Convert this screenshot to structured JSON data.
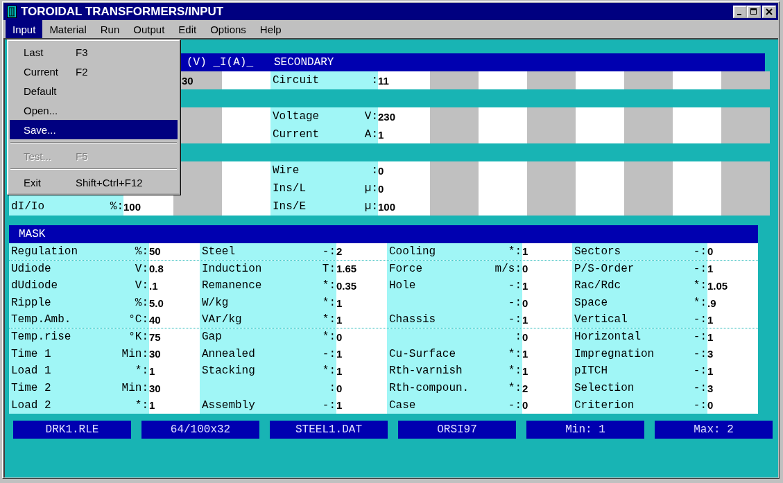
{
  "window": {
    "title": "TOROIDAL TRANSFORMERS/INPUT"
  },
  "menu_bar": [
    {
      "label": "Input",
      "selected": true
    },
    {
      "label": "Material",
      "selected": false
    },
    {
      "label": "Run",
      "selected": false
    },
    {
      "label": "Output",
      "selected": false
    },
    {
      "label": "Edit",
      "selected": false
    },
    {
      "label": "Options",
      "selected": false
    },
    {
      "label": "Help",
      "selected": false
    }
  ],
  "input_menu": [
    {
      "kind": "item",
      "label": "Last",
      "shortcut": "F3",
      "selected": false,
      "disabled": false
    },
    {
      "kind": "item",
      "label": "Current",
      "shortcut": "F2",
      "selected": false,
      "disabled": false
    },
    {
      "kind": "item",
      "label": "Default",
      "selected": false,
      "disabled": false
    },
    {
      "kind": "item",
      "label": "Open...",
      "selected": false,
      "disabled": false
    },
    {
      "kind": "item",
      "label": "Save...",
      "selected": true,
      "disabled": false
    },
    {
      "kind": "separator"
    },
    {
      "kind": "item",
      "label": "Test...",
      "shortcut": "F5",
      "selected": false,
      "disabled": true
    },
    {
      "kind": "separator"
    },
    {
      "kind": "item",
      "label": "Exit",
      "shortcut": "Shift+Ctrl+F12",
      "selected": false,
      "disabled": false
    }
  ],
  "winding_panel": {
    "header": "(V) _I(A)_",
    "secondary_title": "SECONDARY",
    "rows": [
      {
        "kind": "field",
        "column_3": "30",
        "secondary": {
          "label": "Circuit",
          "unit": ":",
          "value": "11"
        }
      },
      {
        "kind": "band"
      },
      {
        "kind": "field",
        "secondary": {
          "label": "Voltage",
          "unit": "V:",
          "value": "230"
        }
      },
      {
        "kind": "field",
        "secondary": {
          "label": "Current",
          "unit": "A:",
          "value": "1"
        }
      },
      {
        "kind": "band"
      },
      {
        "kind": "field",
        "secondary": {
          "label": "Wire",
          "unit": ":",
          "value": "0"
        }
      },
      {
        "kind": "field",
        "secondary": {
          "label": "Ins/L",
          "unit": "µ:",
          "value": "0"
        }
      },
      {
        "kind": "field",
        "primary": {
          "label": "dI/Io",
          "unit": "%:",
          "value": "100"
        },
        "secondary": {
          "label": "Ins/E",
          "unit": "µ:",
          "value": "100"
        }
      }
    ]
  },
  "mask": {
    "title": "MASK",
    "rows": [
      [
        {
          "label": "Regulation",
          "unit": "%:",
          "value": "50"
        },
        {
          "label": "Steel",
          "unit": "-:",
          "value": "2"
        },
        {
          "label": "Cooling",
          "unit": "*:",
          "value": "1"
        },
        {
          "label": "Sectors",
          "unit": "-:",
          "value": "0"
        }
      ],
      [
        {
          "label": "Udiode",
          "unit": "V:",
          "value": "0.8"
        },
        {
          "label": "Induction",
          "unit": "T:",
          "value": "1.65"
        },
        {
          "label": "Force",
          "unit": "m/s:",
          "value": "0"
        },
        {
          "label": "P/S-Order",
          "unit": "-:",
          "value": "1"
        }
      ],
      [
        {
          "label": "dUdiode",
          "unit": "V:",
          "value": ".1"
        },
        {
          "label": "Remanence",
          "unit": "*:",
          "value": "0.35"
        },
        {
          "label": "Hole",
          "unit": "-:",
          "value": "1"
        },
        {
          "label": "Rac/Rdc",
          "unit": "*:",
          "value": "1.05"
        }
      ],
      [
        {
          "label": "Ripple",
          "unit": "%:",
          "value": "5.0"
        },
        {
          "label": "W/kg",
          "unit": "*:",
          "value": "1"
        },
        {
          "unit": "-:",
          "value": "0"
        },
        {
          "label": "Space",
          "unit": "*:",
          "value": ".9"
        }
      ],
      [
        {
          "label": "Temp.Amb.",
          "unit": "°C:",
          "value": "40"
        },
        {
          "label": "VAr/kg",
          "unit": "*:",
          "value": "1"
        },
        {
          "label": "Chassis",
          "unit": "-:",
          "value": "1"
        },
        {
          "label": "Vertical",
          "unit": "-:",
          "value": "1"
        }
      ],
      [
        {
          "label": "Temp.rise",
          "unit": "°K:",
          "value": "75"
        },
        {
          "label": "Gap",
          "unit": "*:",
          "value": "0"
        },
        {
          "unit": ":",
          "value": "0"
        },
        {
          "label": "Horizontal",
          "unit": "-:",
          "value": "1"
        }
      ],
      [
        {
          "label": "Time 1",
          "unit": "Min:",
          "value": "30"
        },
        {
          "label": "Annealed",
          "unit": "-:",
          "value": "1"
        },
        {
          "label": "Cu-Surface",
          "unit": "*:",
          "value": "1"
        },
        {
          "label": "Impregnation",
          "unit": "-:",
          "value": "3"
        }
      ],
      [
        {
          "label": "Load 1",
          "unit": "*:",
          "value": "1"
        },
        {
          "label": "Stacking",
          "unit": "*:",
          "value": "1"
        },
        {
          "label": "Rth-varnish",
          "unit": "*:",
          "value": "1"
        },
        {
          "label": "pITCH",
          "unit": "-:",
          "value": "1"
        }
      ],
      [
        {
          "label": "Time 2",
          "unit": "Min:",
          "value": "30"
        },
        {
          "unit": ":",
          "value": "0"
        },
        {
          "label": "Rth-compoun.",
          "unit": "*:",
          "value": "2"
        },
        {
          "label": "Selection",
          "unit": "-:",
          "value": "3"
        }
      ],
      [
        {
          "label": "Load 2",
          "unit": "*:",
          "value": "1"
        },
        {
          "label": "Assembly",
          "unit": "-:",
          "value": "1"
        },
        {
          "label": "Case",
          "unit": "-:",
          "value": "0"
        },
        {
          "label": "Criterion",
          "unit": "-:",
          "value": "0"
        }
      ]
    ]
  },
  "status_bar": [
    "DRK1.RLE",
    "64/100x32",
    "STEEL1.DAT",
    "ORSI97",
    "Min: 1",
    "Max: 2"
  ]
}
